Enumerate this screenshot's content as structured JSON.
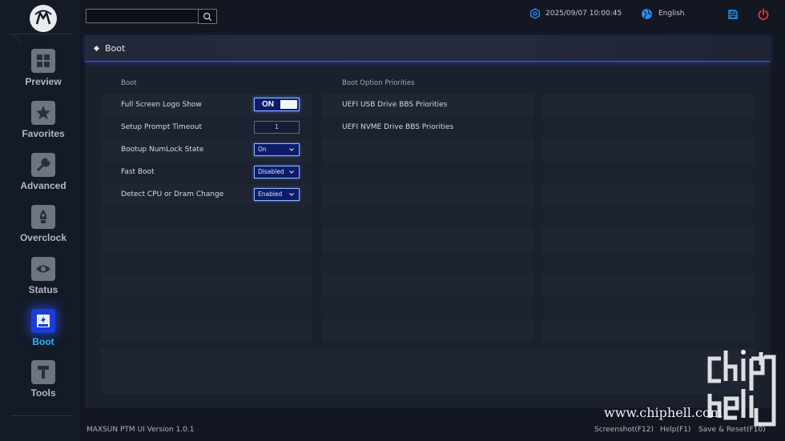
{
  "sidebar": {
    "items": [
      {
        "label": "Preview",
        "icon": "grid-icon"
      },
      {
        "label": "Favorites",
        "icon": "star-icon"
      },
      {
        "label": "Advanced",
        "icon": "wrench-icon"
      },
      {
        "label": "Overclock",
        "icon": "rocket-icon"
      },
      {
        "label": "Status",
        "icon": "eye-icon"
      },
      {
        "label": "Boot",
        "icon": "ssd-icon"
      },
      {
        "label": "Tools",
        "icon": "hammer-icon"
      }
    ],
    "active": "Boot"
  },
  "header": {
    "search_value": "",
    "datetime": "2025/09/07 10:00:45",
    "language": "English"
  },
  "tab": {
    "title": "Boot"
  },
  "boot": {
    "heading": "Boot",
    "settings": [
      {
        "label": "Full Screen Logo Show",
        "control": "toggle",
        "value": "ON"
      },
      {
        "label": "Setup Prompt Timeout",
        "control": "number",
        "value": "1"
      },
      {
        "label": "Bootup NumLock State",
        "control": "select",
        "value": "On"
      },
      {
        "label": "Fast Boot",
        "control": "select",
        "value": "Disabled"
      },
      {
        "label": "Detect CPU or Dram Change",
        "control": "select",
        "value": "Enabled"
      }
    ]
  },
  "boot_priorities": {
    "heading": "Boot Option Priorities",
    "items": [
      {
        "label": "UEFI USB Drive BBS Priorities"
      },
      {
        "label": "UEFI NVME Drive BBS Priorities"
      }
    ]
  },
  "footer": {
    "version": "MAXSUN PTM UI Version 1.0.1",
    "screenshot": "Screenshot(F12)",
    "help": "Help(F1)",
    "save_reset": "Save & Reset(F10)"
  },
  "watermark": {
    "site": "www.chiphell.com"
  },
  "colors": {
    "accent": "#2d5cff",
    "active_label": "#29b6f6",
    "power": "#e53935",
    "save": "#2196f3"
  }
}
